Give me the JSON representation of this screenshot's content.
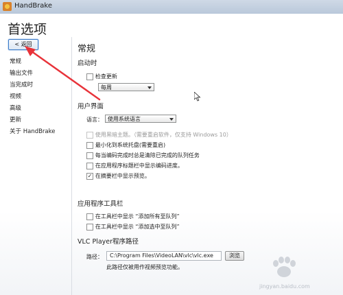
{
  "window": {
    "title": "HandBrake"
  },
  "page": {
    "title": "首选项"
  },
  "back_button": {
    "label": "< 返回"
  },
  "sidebar": {
    "items": [
      {
        "label": "常规"
      },
      {
        "label": "输出文件"
      },
      {
        "label": "当完成时"
      },
      {
        "label": "视频"
      },
      {
        "label": "高级"
      },
      {
        "label": "更新"
      },
      {
        "label": "关于 HandBrake"
      }
    ]
  },
  "general": {
    "title": "常规",
    "startup": {
      "title": "启动时",
      "check_updates_label": "检查更新",
      "check_updates_checked": false,
      "frequency_value": "每周"
    },
    "ui": {
      "title": "用户界面",
      "language_label": "语言：",
      "language_value": "使用系统语言",
      "options": [
        {
          "label": "使用黑暗主题。（需要重启软件，仅支持 Windows 10）",
          "checked": false,
          "disabled": true
        },
        {
          "label": "最小化到系统托盘(需要重启)",
          "checked": false,
          "disabled": false
        },
        {
          "label": "每当编码完成时总是清除已完成的队列任务",
          "checked": false,
          "disabled": false
        },
        {
          "label": "在应用程序标题栏中显示编码进度。",
          "checked": false,
          "disabled": false
        },
        {
          "label": "在摘要栏中显示预览。",
          "checked": true,
          "disabled": false
        }
      ]
    },
    "toolbar": {
      "title": "应用程序工具栏",
      "options": [
        {
          "label": "在工具栏中显示 “添加所有至队列”",
          "checked": false
        },
        {
          "label": "在工具栏中显示 “添加选中至队列”",
          "checked": false
        }
      ]
    },
    "vlc": {
      "title": "VLC Player程序路径",
      "path_label": "路径：",
      "path_value": "C:\\Program Files\\VideoLAN\\vlc\\vlc.exe",
      "browse_label": "浏览",
      "hint": "此路径仅被用作视频预览功能。"
    }
  },
  "watermark": {
    "site": "jingyan.baidu.com"
  },
  "colors": {
    "annotation_arrow": "#e8333a",
    "focus_border": "#3d7cc9"
  }
}
